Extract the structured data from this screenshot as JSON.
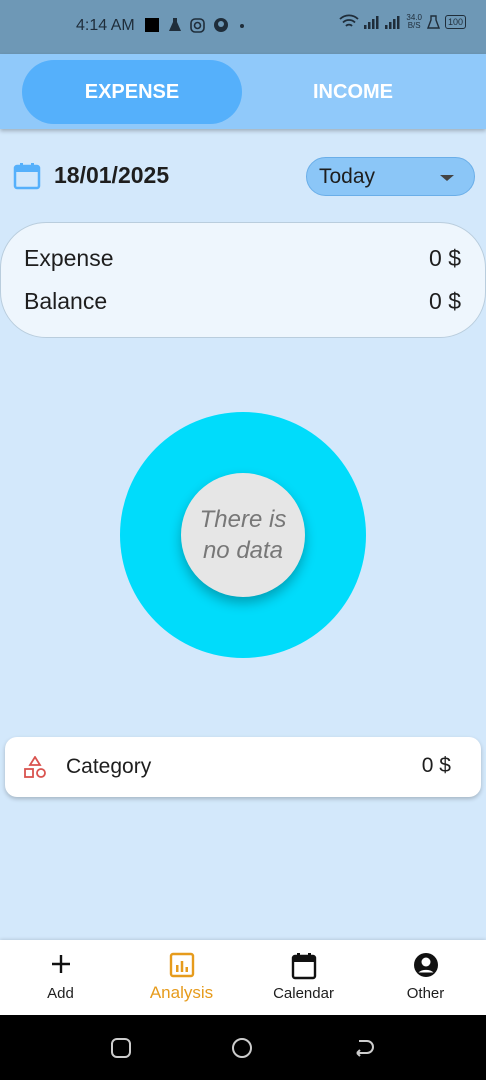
{
  "status_bar": {
    "time": "4:14 AM",
    "net_speed_value": "34.0",
    "net_speed_unit": "B/S",
    "battery": "100"
  },
  "tabs": [
    {
      "label": "EXPENSE",
      "active": true
    },
    {
      "label": "INCOME",
      "active": false
    }
  ],
  "date_row": {
    "date": "18/01/2025",
    "period": "Today"
  },
  "summary": {
    "expense_label": "Expense",
    "expense_value": "0 $",
    "balance_label": "Balance",
    "balance_value": "0 $"
  },
  "chart": {
    "empty_message": "There is no data",
    "ring_color": "#00DCFB"
  },
  "category": {
    "name": "Category",
    "value": "0 $"
  },
  "bottom_nav": [
    {
      "label": "Add",
      "icon": "plus-icon"
    },
    {
      "label": "Analysis",
      "icon": "analysis-icon",
      "active": true
    },
    {
      "label": "Calendar",
      "icon": "calendar-icon"
    },
    {
      "label": "Other",
      "icon": "account-circle-icon"
    }
  ],
  "colors": {
    "accent": "#55B0FB",
    "active_nav": "#E69B1C",
    "category_icon": "#D9534F"
  }
}
